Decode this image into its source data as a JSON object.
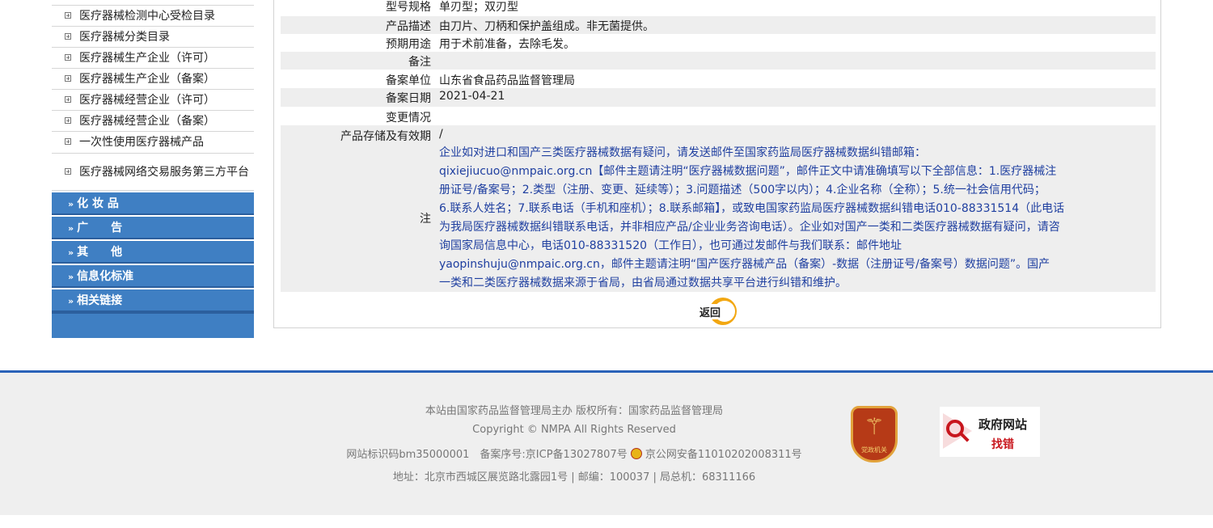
{
  "sidebar": {
    "items": [
      {
        "label": "医疗器械检测中心受检目录"
      },
      {
        "label": "医疗器械分类目录"
      },
      {
        "label": "医疗器械生产企业（许可）"
      },
      {
        "label": "医疗器械生产企业（备案）"
      },
      {
        "label": "医疗器械经营企业（许可）"
      },
      {
        "label": "医疗器械经营企业（备案）"
      },
      {
        "label": "一次性使用医疗器械产品"
      },
      {
        "label": "医疗器械网络交易服务第三方平台"
      }
    ],
    "categories": [
      {
        "label": "化 妆 品"
      },
      {
        "label": "广　　告"
      },
      {
        "label": "其　　他"
      },
      {
        "label": "信息化标准"
      },
      {
        "label": "相关链接"
      }
    ]
  },
  "detail": {
    "rows": [
      {
        "key": "型号规格",
        "value": "单刃型；双刃型"
      },
      {
        "key": "产品描述",
        "value": "由刀片、刀柄和保护盖组成。非无菌提供。"
      },
      {
        "key": "预期用途",
        "value": "用于术前准备，去除毛发。"
      },
      {
        "key": "备注",
        "value": ""
      },
      {
        "key": "备案单位",
        "value": "山东省食品药品监督管理局"
      },
      {
        "key": "备案日期",
        "value": "2021-04-21"
      },
      {
        "key": "变更情况",
        "value": ""
      },
      {
        "key": "产品存储及有效期",
        "value": "/"
      }
    ],
    "note_key": "注",
    "note_lines": [
      "企业如对进口和国产三类医疗器械数据有疑问，请发送邮件至国家药监局医疗器械数据纠错邮箱：",
      "qixiejiucuo@nmpaic.org.cn【邮件主题请注明“医疗器械数据问题”，邮件正文中请准确填写以下全部信息：1.医疗器械注",
      "册证号/备案号；2.类型（注册、变更、延续等）；3.问题描述（500字以内）；4.企业名称（全称）；5.统一社会信用代码；",
      "6.联系人姓名；7.联系电话（手机和座机）；8.联系邮箱】，或致电国家药监局医疗器械数据纠错电话010-88331514（此电话",
      "为我局医疗器械数据纠错联系电话，并非相应产品/企业业务咨询电话）。企业如对国产一类和二类医疗器械数据有疑问，请咨",
      "询国家局信息中心，电话010-88331520（工作日），也可通过发邮件与我们联系：邮件地址",
      "yaopinshuju@nmpaic.org.cn，邮件主题请注明“国产医疗器械产品（备案）-数据（注册证号/备案号）数据问题”。国产",
      "一类和二类医疗器械数据来源于省局，由省局通过数据共享平台进行纠错和维护。"
    ],
    "return_label": "返回"
  },
  "footer": {
    "line1": "本站由国家药品监督管理局主办 版权所有：国家药品监督管理局",
    "line2": "Copyright © NMPA All Rights Reserved",
    "line3a": "网站标识码bm35000001　备案序号:京ICP备13027807号",
    "line3b": "京公网安备11010202008311号",
    "line4": "地址：北京市西城区展览路北露园1号 | 邮编：100037 | 局总机：68311166",
    "badge1_caption": "党政机关",
    "badge2_title": "政府网站",
    "badge2_sub": "找错"
  },
  "colors": {
    "sidebar_blue": "#3f7fc3",
    "footer_line": "#2a62b8",
    "note_text": "#1f3fa0"
  }
}
